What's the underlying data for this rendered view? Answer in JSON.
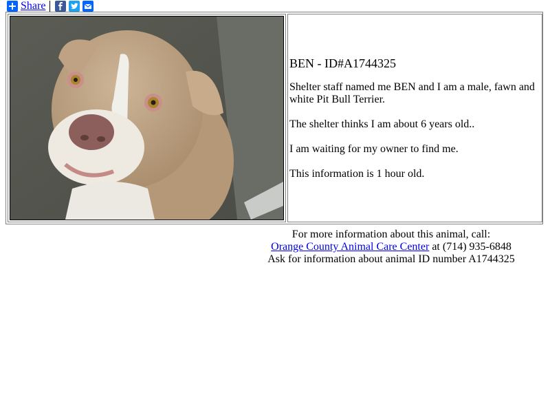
{
  "share": {
    "label": "Share",
    "buttons": [
      {
        "name": "facebook-icon",
        "color": "#3b5998"
      },
      {
        "name": "twitter-icon",
        "color": "#1da1f2"
      },
      {
        "name": "email-icon",
        "color": "#0166ff"
      }
    ],
    "accent": "#0166ff"
  },
  "animal": {
    "title": "BEN - ID#A1744325",
    "lines": [
      "Shelter staff named me BEN and I am a male, fawn and white Pit Bull Terrier.",
      "The shelter thinks I am about 6 years old..",
      "I am waiting for my owner to find me.",
      "This information is 1 hour old."
    ],
    "photo_alt": "Photo of BEN, a fawn and white Pit Bull Terrier"
  },
  "footer": {
    "line1": "For more information about this animal, call:",
    "shelter_link": "Orange County Animal Care Center",
    "phone_text": " at (714) 935-6848",
    "line3": "Ask for information about animal ID number A1744325"
  }
}
